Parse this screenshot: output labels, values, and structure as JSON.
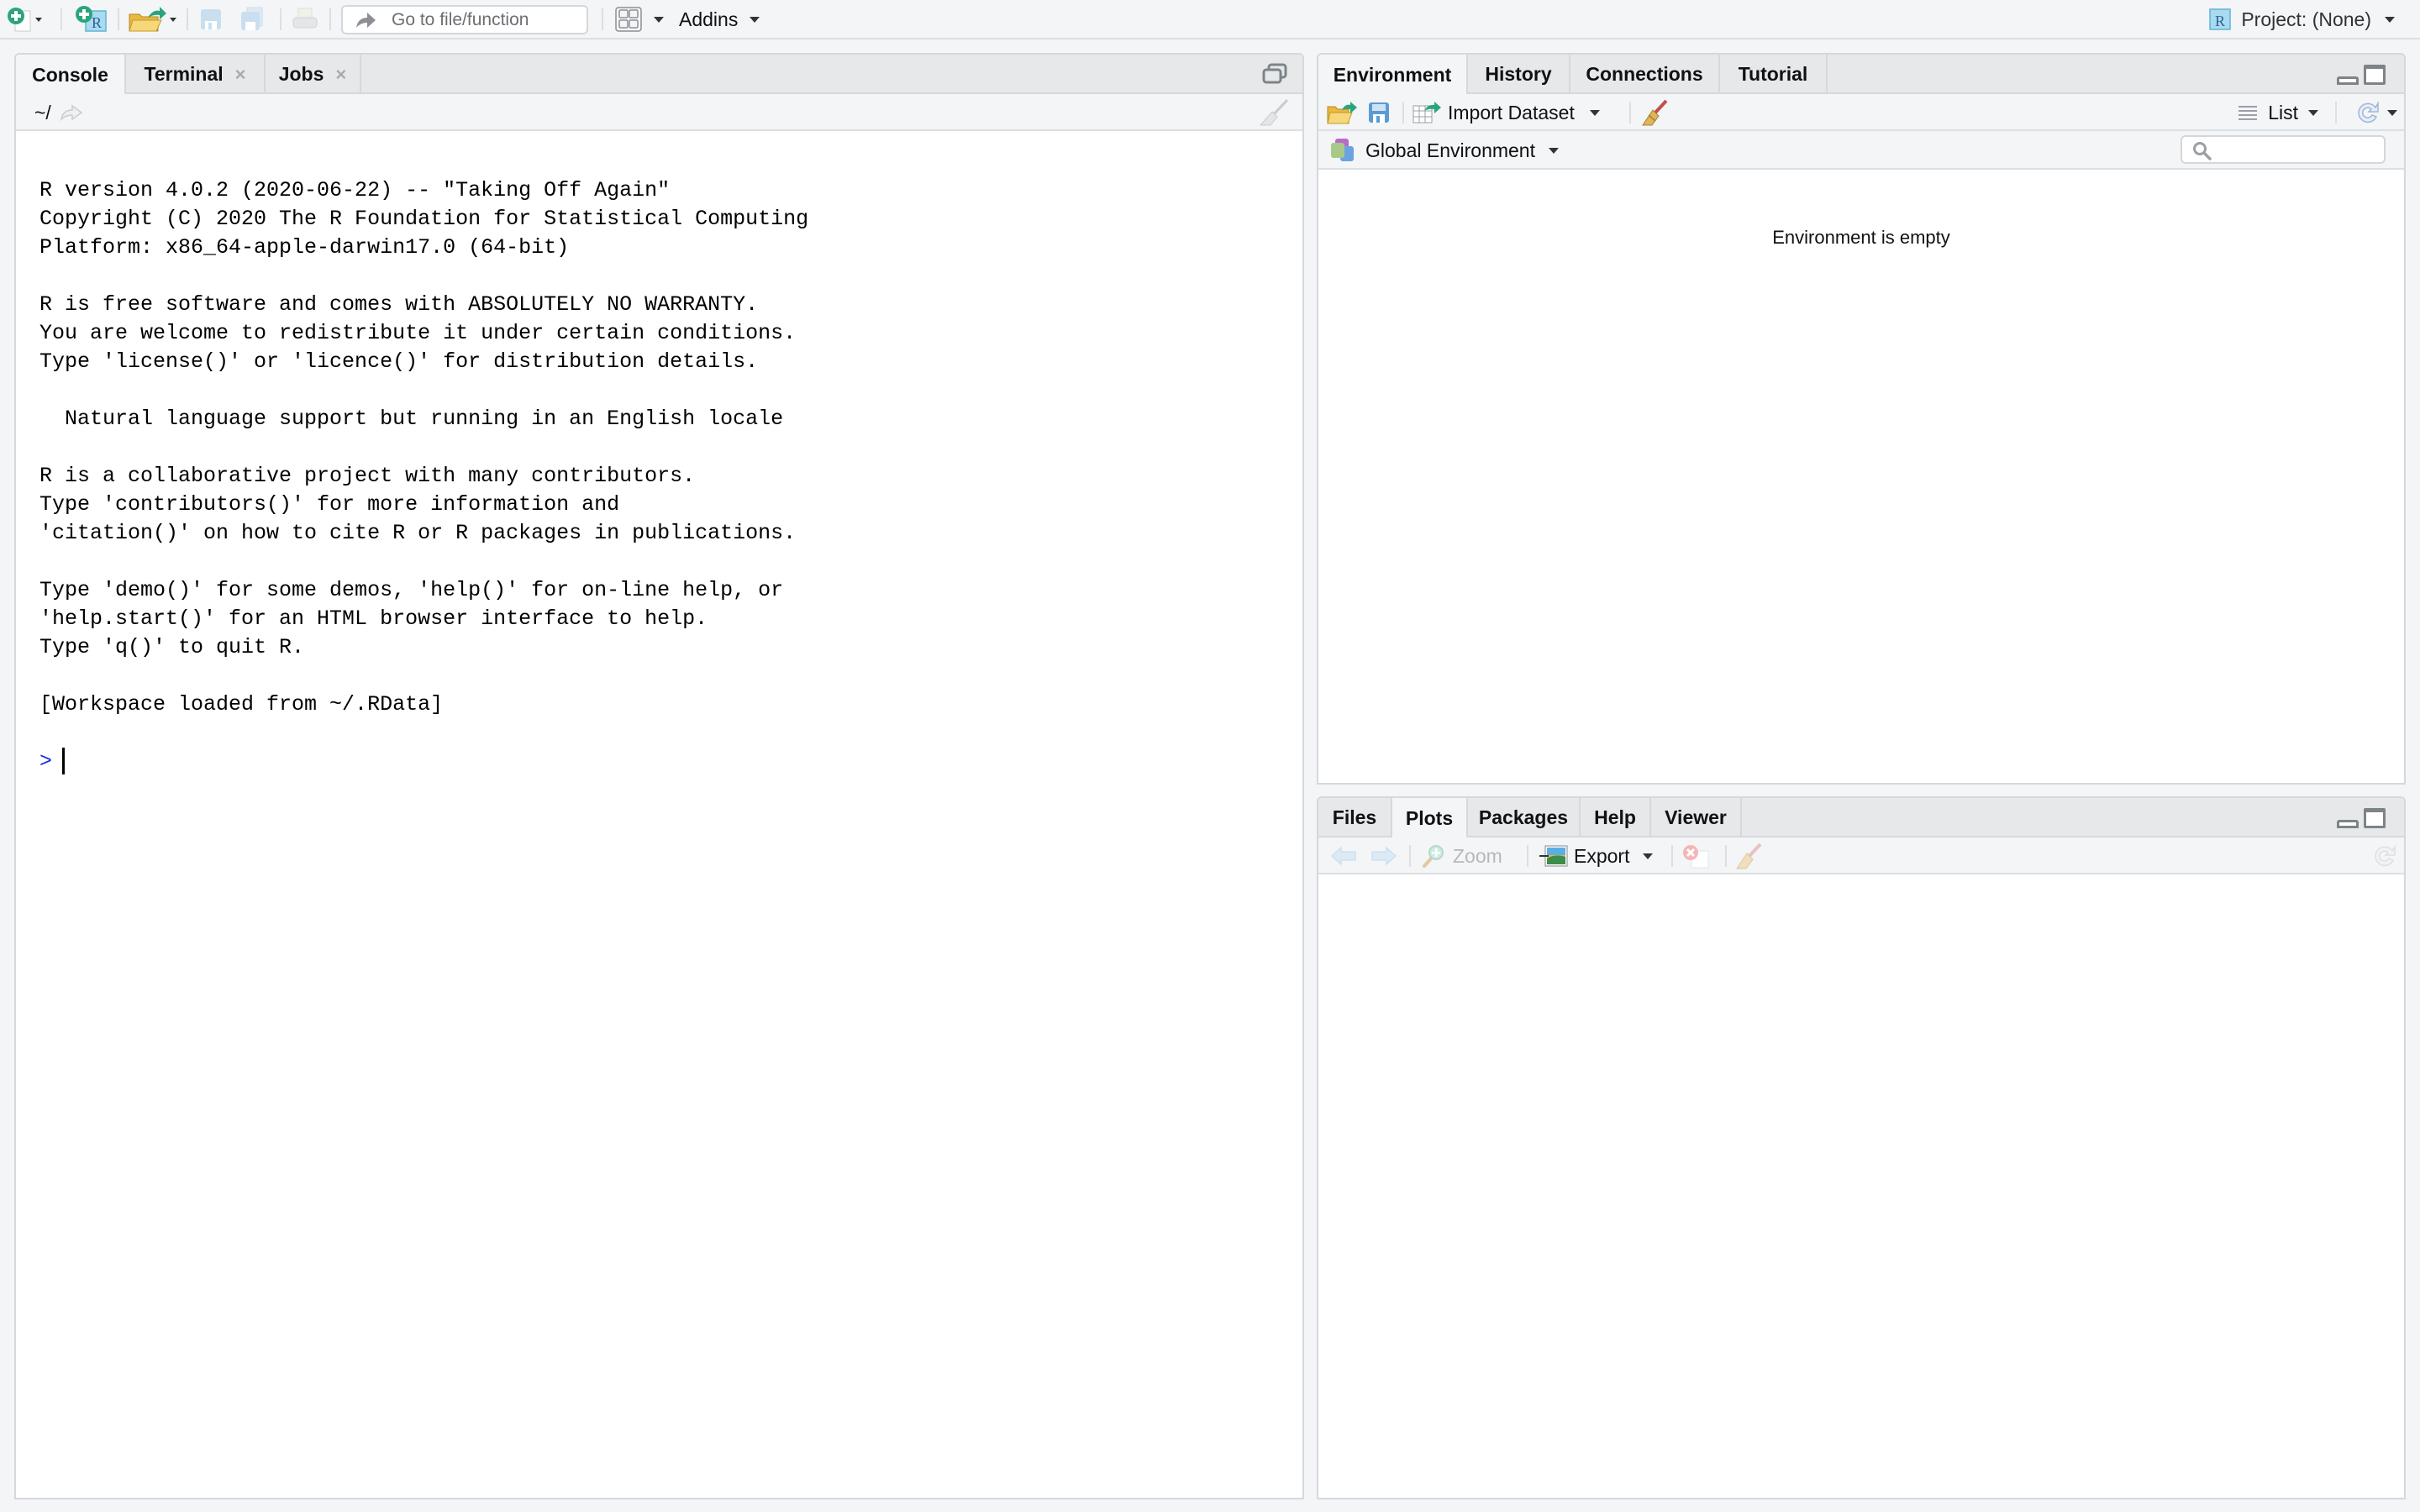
{
  "topbar": {
    "new_file_icon": "new-file-icon",
    "new_project_icon": "new-project-icon",
    "open_file_icon": "open-file-icon",
    "save_icon": "save-icon",
    "save_all_icon": "save-all-icon",
    "print_icon": "print-icon",
    "goto_placeholder": "Go to file/function",
    "layout_icon": "grid-layout-icon",
    "addins_label": "Addins",
    "project_label": "Project: (None)"
  },
  "console_pane": {
    "tabs": [
      {
        "label": "Console",
        "active": true,
        "closable": false
      },
      {
        "label": "Terminal",
        "active": false,
        "closable": true
      },
      {
        "label": "Jobs",
        "active": false,
        "closable": true
      }
    ],
    "close_glyph": "×",
    "path": "~/",
    "lines": [
      "",
      "R version 4.0.2 (2020-06-22) -- \"Taking Off Again\"",
      "Copyright (C) 2020 The R Foundation for Statistical Computing",
      "Platform: x86_64-apple-darwin17.0 (64-bit)",
      "",
      "R is free software and comes with ABSOLUTELY NO WARRANTY.",
      "You are welcome to redistribute it under certain conditions.",
      "Type 'license()' or 'licence()' for distribution details.",
      "",
      "  Natural language support but running in an English locale",
      "",
      "R is a collaborative project with many contributors.",
      "Type 'contributors()' for more information and",
      "'citation()' on how to cite R or R packages in publications.",
      "",
      "Type 'demo()' for some demos, 'help()' for on-line help, or",
      "'help.start()' for an HTML browser interface to help.",
      "Type 'q()' to quit R.",
      "",
      "[Workspace loaded from ~/.RData]",
      ""
    ],
    "prompt": ">"
  },
  "env_pane": {
    "tabs": [
      {
        "label": "Environment",
        "active": true
      },
      {
        "label": "History",
        "active": false
      },
      {
        "label": "Connections",
        "active": false
      },
      {
        "label": "Tutorial",
        "active": false
      }
    ],
    "import_label": "Import Dataset",
    "view_label": "List",
    "scope_label": "Global Environment",
    "search_placeholder": "",
    "empty_message": "Environment is empty"
  },
  "files_pane": {
    "tabs": [
      {
        "label": "Files",
        "active": false
      },
      {
        "label": "Plots",
        "active": true
      },
      {
        "label": "Packages",
        "active": false
      },
      {
        "label": "Help",
        "active": false
      },
      {
        "label": "Viewer",
        "active": false
      }
    ],
    "zoom_label": "Zoom",
    "export_label": "Export"
  },
  "colors": {
    "prompt": "#1a2cd8",
    "accent_green": "#2aa57b",
    "panel_bg": "#f3f5f7",
    "border": "#d5d8dc"
  }
}
